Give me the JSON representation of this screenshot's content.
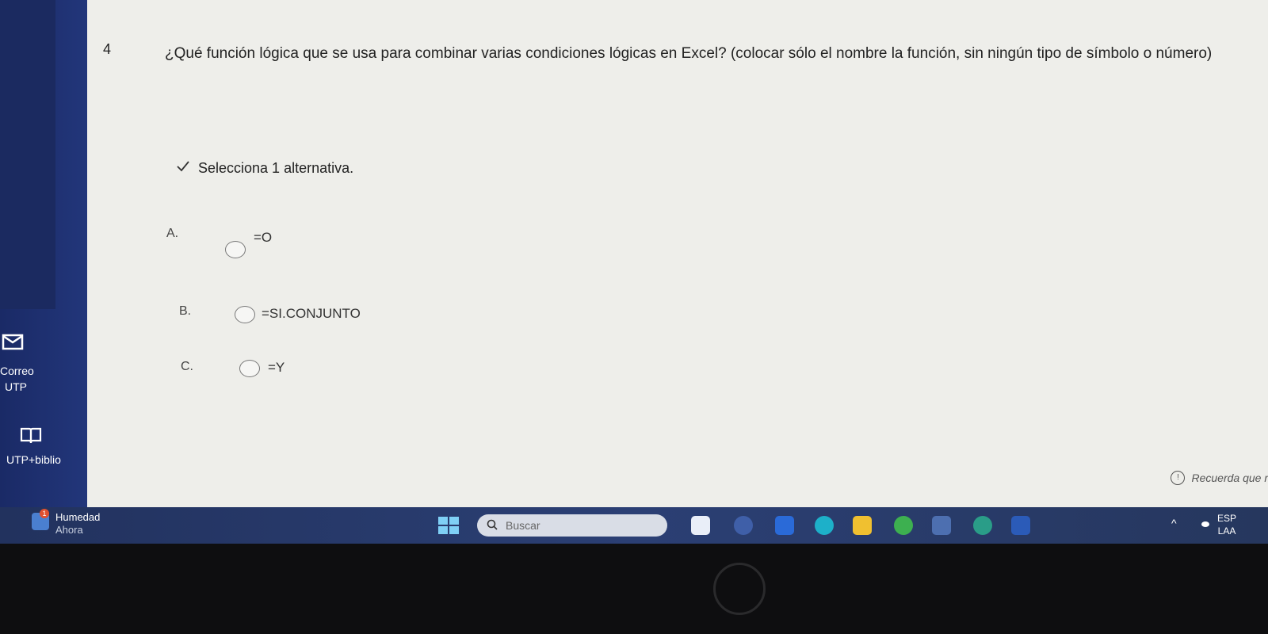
{
  "sidebar": {
    "items": [
      {
        "label_line1": "Correo",
        "label_line2": "UTP",
        "icon": "mail-icon"
      },
      {
        "label_line1": "UTP+biblio",
        "icon": "book-icon"
      }
    ]
  },
  "question": {
    "number": "4",
    "text": "¿Qué función lógica que se usa para combinar varias condiciones lógicas en Excel? (colocar sólo el nombre la función, sin ningún tipo de símbolo o número)",
    "instruction": "Selecciona 1 alternativa.",
    "options": [
      {
        "letter": "A.",
        "label": "=O"
      },
      {
        "letter": "B.",
        "label": "=SI.CONJUNTO"
      },
      {
        "letter": "C.",
        "label": "=Y"
      }
    ],
    "hint": "Recuerda que r"
  },
  "taskbar": {
    "weather_badge": "1",
    "weather_title": "Humedad",
    "weather_subtitle": "Ahora",
    "search_placeholder": "Buscar",
    "lang_line1": "ESP",
    "lang_line2": "LAA"
  }
}
